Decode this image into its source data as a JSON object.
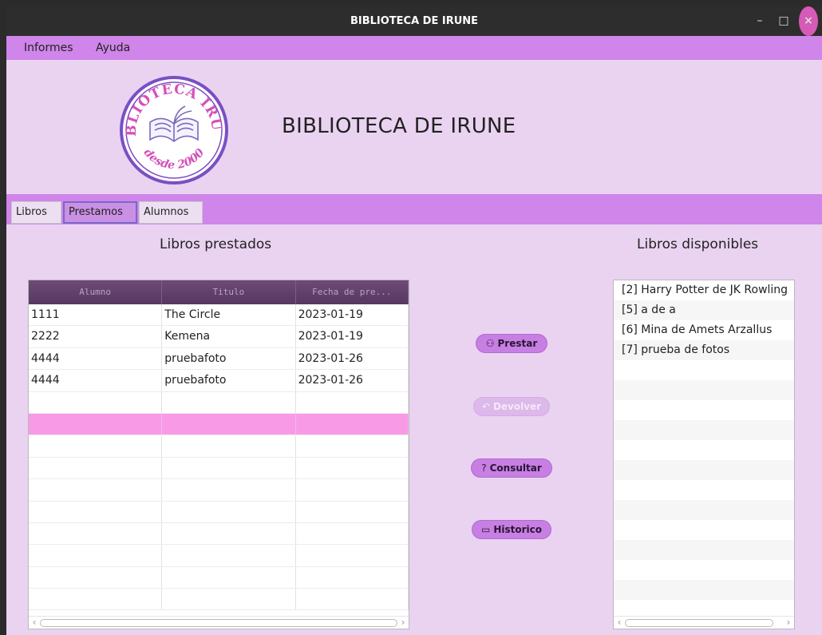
{
  "window": {
    "title": "BIBLIOTECA DE IRUNE",
    "controls": {
      "minimize": "–",
      "maximize": "□",
      "close": "×"
    }
  },
  "menubar": {
    "items": [
      {
        "label": "Informes"
      },
      {
        "label": "Ayuda"
      }
    ]
  },
  "header": {
    "logo_text_top": "BIBLIOTECA IRUNE",
    "logo_text_bottom": "desde 2000",
    "title": "BIBLIOTECA DE IRUNE"
  },
  "tabs": [
    {
      "label": "Libros",
      "active": false
    },
    {
      "label": "Prestamos",
      "active": true
    },
    {
      "label": "Alumnos",
      "active": false
    }
  ],
  "loans": {
    "title": "Libros prestados",
    "columns": [
      "Alumno",
      "Titulo",
      "Fecha de pre..."
    ],
    "rows": [
      [
        "1111",
        "The Circle",
        "2023-01-19"
      ],
      [
        "2222",
        "Kemena",
        "2023-01-19"
      ],
      [
        "4444",
        "pruebafoto",
        "2023-01-26"
      ],
      [
        "4444",
        "pruebafoto",
        "2023-01-26"
      ],
      [
        "",
        "",
        ""
      ],
      [
        "",
        "",
        ""
      ],
      [
        "",
        "",
        ""
      ],
      [
        "",
        "",
        ""
      ],
      [
        "",
        "",
        ""
      ],
      [
        "",
        "",
        ""
      ],
      [
        "",
        "",
        ""
      ],
      [
        "",
        "",
        ""
      ],
      [
        "",
        "",
        ""
      ],
      [
        "",
        "",
        ""
      ]
    ],
    "selected_row": 5
  },
  "actions": {
    "prestar": {
      "label": "Prestar",
      "icon": "handshake-icon",
      "enabled": true
    },
    "devolver": {
      "label": "Devolver",
      "icon": "reply-icon",
      "enabled": false
    },
    "consultar": {
      "label": "Consultar",
      "icon": "help-circle-icon",
      "enabled": true
    },
    "historico": {
      "label": "Historico",
      "icon": "folder-open-icon",
      "enabled": true
    }
  },
  "available": {
    "title": "Libros disponibles",
    "items": [
      "[2] Harry Potter de JK Rowling",
      "[5] a de a",
      "[6] Mina de Amets Arzallus",
      "[7] prueba de fotos",
      "",
      "",
      "",
      "",
      "",
      "",
      "",
      "",
      "",
      "",
      "",
      "",
      ""
    ]
  },
  "colors": {
    "menubar": "#cf85ea",
    "window_bg": "#ead3f1",
    "header_row": "#5e3f68",
    "selected_row": "#f89ae6",
    "button": "#c77fe3",
    "close_button": "#d65ab7"
  }
}
